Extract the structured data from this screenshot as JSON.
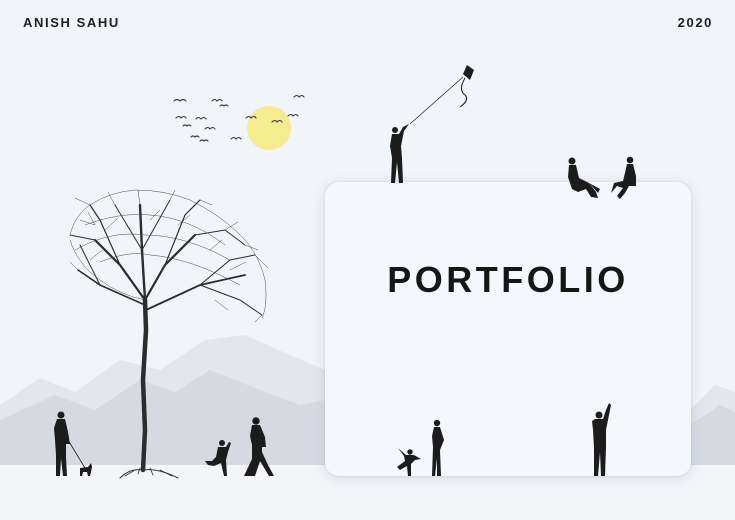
{
  "header": {
    "author": "ANISH SAHU",
    "year": "2020"
  },
  "card": {
    "title": "PORTFOLIO"
  },
  "colors": {
    "background": "#f1f4f9",
    "sun": "#f4ec8f",
    "silhouette": "#1c1c1c",
    "mountains": "#d9dde3"
  },
  "icons": [
    "sun-icon",
    "birds-flock-icon",
    "tree-icon",
    "kite-icon",
    "person-silhouette-icon",
    "dog-icon"
  ]
}
